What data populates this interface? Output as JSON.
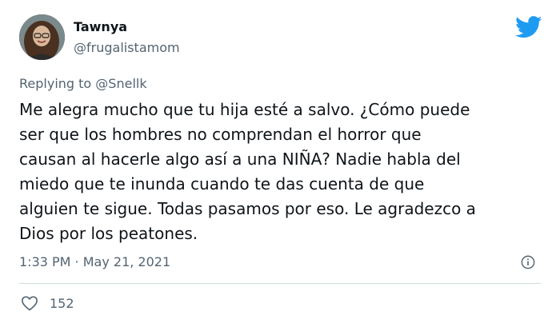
{
  "author": {
    "name": "Tawnya",
    "handle": "@frugalistamom"
  },
  "reply": {
    "prefix": "Replying to",
    "mention": "@Snellk"
  },
  "tweet": {
    "lines": [
      "Me alegra mucho que tu hija esté a salvo. ¿Cómo puede",
      "ser que los hombres no comprendan el horror que",
      "causan al hacerle algo así a una NIÑA? Nadie habla del",
      "miedo que te inunda cuando te das cuenta de que",
      "alguien te sigue. Todas pasamos por eso. Le agradezco a",
      "Dios por los peatones."
    ],
    "timestamp": "1:33 PM · May 21, 2021",
    "likes": "152"
  },
  "icons": {
    "brand": "twitter-bird-icon",
    "info": "info-icon",
    "like": "heart-icon"
  },
  "colors": {
    "brand": "#1d9bf0",
    "text": "#0f1419",
    "secondary": "#536471",
    "divider": "#cfd9de"
  }
}
